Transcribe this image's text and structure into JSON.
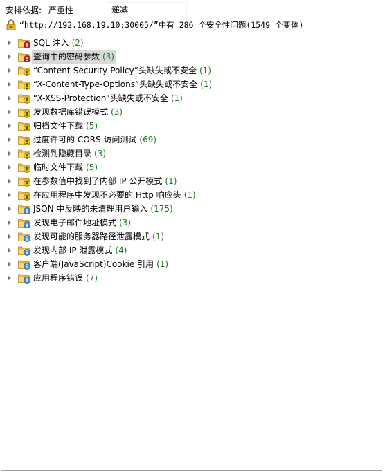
{
  "sort": {
    "label": "安排依据:",
    "option_selected": "严重性",
    "option_other": "递减"
  },
  "summary": {
    "text": "“http://192.168.19.10:30005/”中有 286 个安全性问题(1549 个变体)"
  },
  "colors": {
    "high": "#d4161c",
    "medium": "#f2c200",
    "low": "#3a8ed8",
    "folder": "#f0c24a",
    "count": "#1a7a1a"
  },
  "issues": [
    {
      "label": "SQL 注入",
      "count": "(2)",
      "severity": "high",
      "selected": false
    },
    {
      "label": "查询中的密码参数",
      "count": "(3)",
      "severity": "high",
      "selected": true
    },
    {
      "label": "“Content-Security-Policy”头缺失或不安全",
      "count": "(1)",
      "severity": "medium",
      "selected": false
    },
    {
      "label": "“X-Content-Type-Options”头缺失或不安全",
      "count": "(1)",
      "severity": "medium",
      "selected": false
    },
    {
      "label": "“X-XSS-Protection”头缺失或不安全",
      "count": "(1)",
      "severity": "medium",
      "selected": false
    },
    {
      "label": "发现数据库错误模式",
      "count": "(3)",
      "severity": "medium",
      "selected": false
    },
    {
      "label": "归档文件下载",
      "count": "(5)",
      "severity": "medium",
      "selected": false
    },
    {
      "label": "过度许可的 CORS 访问测试",
      "count": "(69)",
      "severity": "medium",
      "selected": false
    },
    {
      "label": "检测到隐藏目录",
      "count": "(3)",
      "severity": "medium",
      "selected": false
    },
    {
      "label": "临时文件下载",
      "count": "(5)",
      "severity": "medium",
      "selected": false
    },
    {
      "label": "在参数值中找到了内部 IP 公开模式",
      "count": "(1)",
      "severity": "medium",
      "selected": false
    },
    {
      "label": "在应用程序中发现不必要的 Http 响应头",
      "count": "(1)",
      "severity": "medium",
      "selected": false
    },
    {
      "label": "JSON 中反映的未清理用户输入",
      "count": "(175)",
      "severity": "low",
      "selected": false
    },
    {
      "label": "发现电子邮件地址模式",
      "count": "(3)",
      "severity": "low",
      "selected": false
    },
    {
      "label": "发现可能的服务器路径泄露模式",
      "count": "(1)",
      "severity": "low",
      "selected": false
    },
    {
      "label": "发现内部 IP 泄露模式",
      "count": "(4)",
      "severity": "low",
      "selected": false
    },
    {
      "label": "客户端(JavaScript)Cookie 引用",
      "count": "(1)",
      "severity": "low",
      "selected": false
    },
    {
      "label": "应用程序错误",
      "count": "(7)",
      "severity": "low",
      "selected": false
    }
  ]
}
